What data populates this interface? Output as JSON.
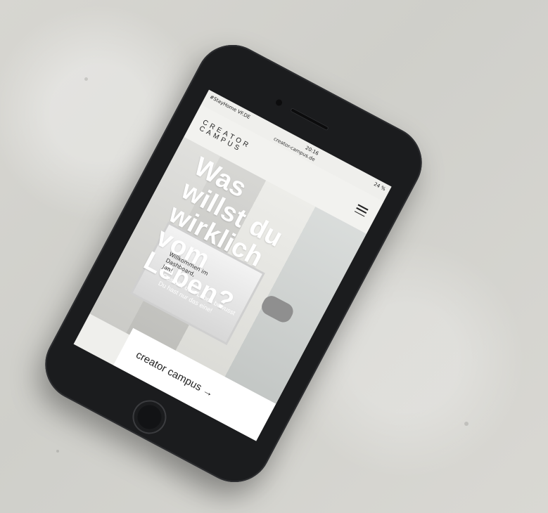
{
  "status": {
    "carrier": "#StayHome VF.DE",
    "time": "20:16",
    "battery": "24 %"
  },
  "browser": {
    "url": "creator-campus.de"
  },
  "site": {
    "logo_line1": "CREATOR",
    "logo_line2": "CAMPUS",
    "headline": "Was\nwillst du\nwirklich\nvom\nLeben?",
    "dashboard_text": "Willkommen im\nDashboard,\nJan!",
    "subline": "Gestalte dein Leben bewusst\nDu hast nur das eine!",
    "cta_label": "creator campus →"
  }
}
